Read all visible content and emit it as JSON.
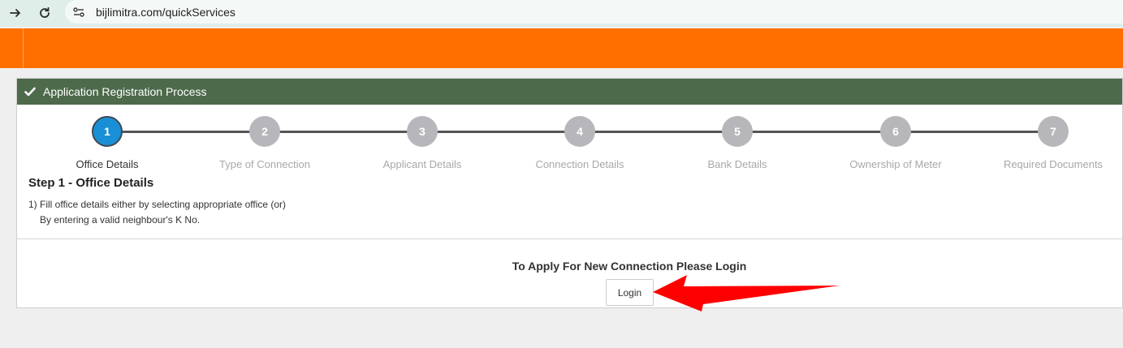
{
  "browser": {
    "url": "bijlimitra.com/quickServices",
    "icons": [
      "arrow-forward-icon",
      "reload-icon",
      "site-settings-icon"
    ]
  },
  "panel": {
    "title": "Application Registration Process",
    "title_icon": "checkmark-icon",
    "heading_color": "#4d6a4a"
  },
  "steps": [
    {
      "number": "1",
      "label": "Office Details",
      "active": true
    },
    {
      "number": "2",
      "label": "Type of Connection",
      "active": false
    },
    {
      "number": "3",
      "label": "Applicant Details",
      "active": false
    },
    {
      "number": "4",
      "label": "Connection Details",
      "active": false
    },
    {
      "number": "5",
      "label": "Bank Details",
      "active": false
    },
    {
      "number": "6",
      "label": "Ownership of Meter",
      "active": false
    },
    {
      "number": "7",
      "label": "Required Documents",
      "active": false
    }
  ],
  "content": {
    "step_title": "Step 1 - Office Details",
    "instruction_line1": "1) Fill office details either by selecting appropriate office (or)",
    "instruction_line2": "By entering a valid neighbour's K No.",
    "login_message": "To Apply For New Connection Please Login",
    "login_button": "Login"
  },
  "colors": {
    "header_orange": "#ff6f00",
    "active_step": "#1b8fd6",
    "inactive_step": "#b7b7bb",
    "annotation_arrow": "#ff0000"
  }
}
